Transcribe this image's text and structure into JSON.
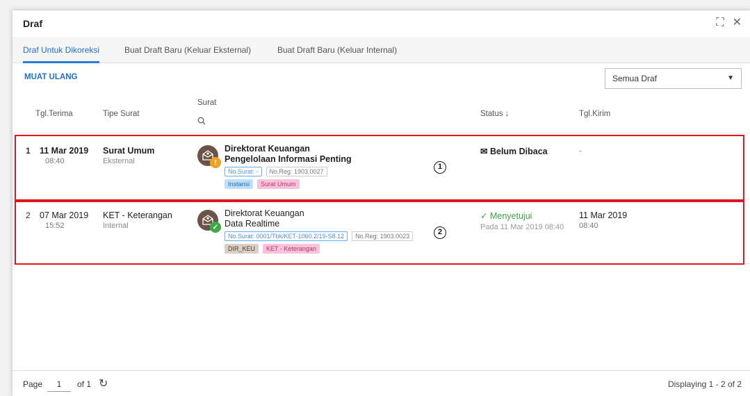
{
  "window": {
    "title": "Draf"
  },
  "tabs": [
    {
      "label": "Draf Untuk Dikoreksi",
      "active": true
    },
    {
      "label": "Buat Draft Baru (Keluar Eksternal)",
      "active": false
    },
    {
      "label": "Buat Draft Baru (Keluar Internal)",
      "active": false
    }
  ],
  "toolbar": {
    "reload_label": "MUAT ULANG",
    "filter_value": "Semua Draf"
  },
  "columns": {
    "tgl_terima": "Tgl.Terima",
    "tipe_surat": "Tipe Surat",
    "surat": "Surat",
    "status": "Status ↓",
    "tgl_kirim": "Tgl.Kirim"
  },
  "rows": [
    {
      "num": "1",
      "date": "11 Mar 2019",
      "time": "08:40",
      "type": "Surat Umum",
      "subtype": "Eksternal",
      "org": "Direktorat Keuangan",
      "subject": "Pengelolaan Informasi Penting",
      "no_surat": "No.Surat: -",
      "no_reg": "No.Reg: 1903.0027",
      "tag_1": "Instansi",
      "tag_2": "Surat Umum",
      "status": "Belum Dibaca",
      "status_sub": "",
      "kirim_date": "-",
      "kirim_time": "",
      "marker": "1"
    },
    {
      "num": "2",
      "date": "07 Mar 2019",
      "time": "15:52",
      "type": "KET - Keterangan",
      "subtype": "Internal",
      "org": "Direktorat Keuangan",
      "subject": "Data Realtime",
      "no_surat": "No.Surat: 0001/Tbk/KET-1060.2/19-S8.12",
      "no_reg": "No.Reg: 1903.0023",
      "tag_1": "DIR_KEU",
      "tag_2": "KET - Keterangan",
      "status": "Menyetujui",
      "status_sub": "Pada 11 Mar 2019 08:40",
      "kirim_date": "11 Mar 2019",
      "kirim_time": "08:40",
      "marker": "2"
    }
  ],
  "footer": {
    "page_label": "Page",
    "page_value": "1",
    "of_label": "of 1",
    "display": "Displaying 1 - 2 of 2"
  },
  "colors": {
    "accent": "#1e6fc4",
    "highlight": "#e0161b",
    "ok": "#3aa04a",
    "warn": "#f0a11e"
  }
}
